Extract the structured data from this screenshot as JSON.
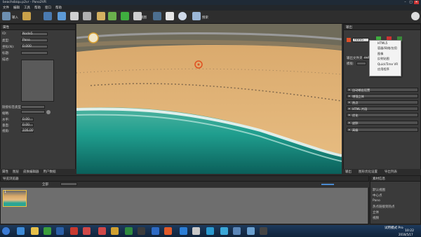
{
  "window": {
    "title": "beachsbiqu.p2vr - Pano2VR",
    "min": "–",
    "max": "□",
    "close": "✕"
  },
  "menu": [
    "文件",
    "编辑",
    "工具",
    "帮助",
    "窗口",
    "帮助"
  ],
  "toolbar": {
    "input_label": "输入",
    "camera_label": "视图",
    "search_label": "搜索"
  },
  "left_panel": {
    "tab": "属性",
    "rows": [
      {
        "label": "ID:",
        "value": "Node5"
      },
      {
        "label": "类型:",
        "value": "Pano"
      },
      {
        "label": "坐标(N):",
        "value": "0.000"
      },
      {
        "label": "标题:",
        "value": ""
      },
      {
        "label": "描述:",
        "value": ""
      }
    ],
    "lower_rows": [
      {
        "label": "链接标签类型(F):",
        "value": ""
      },
      {
        "label": "缩略:",
        "value": ""
      },
      {
        "label": "水平:",
        "value": "0.00"
      },
      {
        "label": "垂直:",
        "value": "0.00"
      },
      {
        "label": "视角:",
        "value": "106.00"
      }
    ],
    "bottom_tabs": [
      "属性",
      "图层",
      "皮肤编辑器",
      "用户数据"
    ]
  },
  "right_panel": {
    "tab": "输出",
    "format": "html5",
    "label_output": "输出文件夹:",
    "output_value": "output",
    "label_template": "模板:",
    "sections": [
      "自动输出设置",
      "增强立体",
      "热点",
      "HTML 片段",
      "优化",
      "皮肤",
      "高级"
    ],
    "bottom_tabs": [
      "输出",
      "图形优化设置",
      "导出列表"
    ]
  },
  "dropdown": {
    "items": [
      "HTML5",
      "容器/网络/应用",
      "图像",
      "反射贴图",
      "QuickTime VR",
      "应用程序"
    ]
  },
  "bottom": {
    "tab": "导览浏览器",
    "filter_label": "全部",
    "thumb_label": "1",
    "right_tab": "素材信息",
    "checks": [
      "默认视图",
      "中心点",
      "Pano",
      "热点链接到热点",
      "立体",
      "视频"
    ]
  },
  "taskbar": {
    "time": "10:22",
    "date": "2016/5/17",
    "mode": "试用模式 Pro"
  },
  "colors": {
    "accent": "#2e6cb8",
    "sand": "#e0b37a",
    "sea": "#1f9e8e"
  }
}
